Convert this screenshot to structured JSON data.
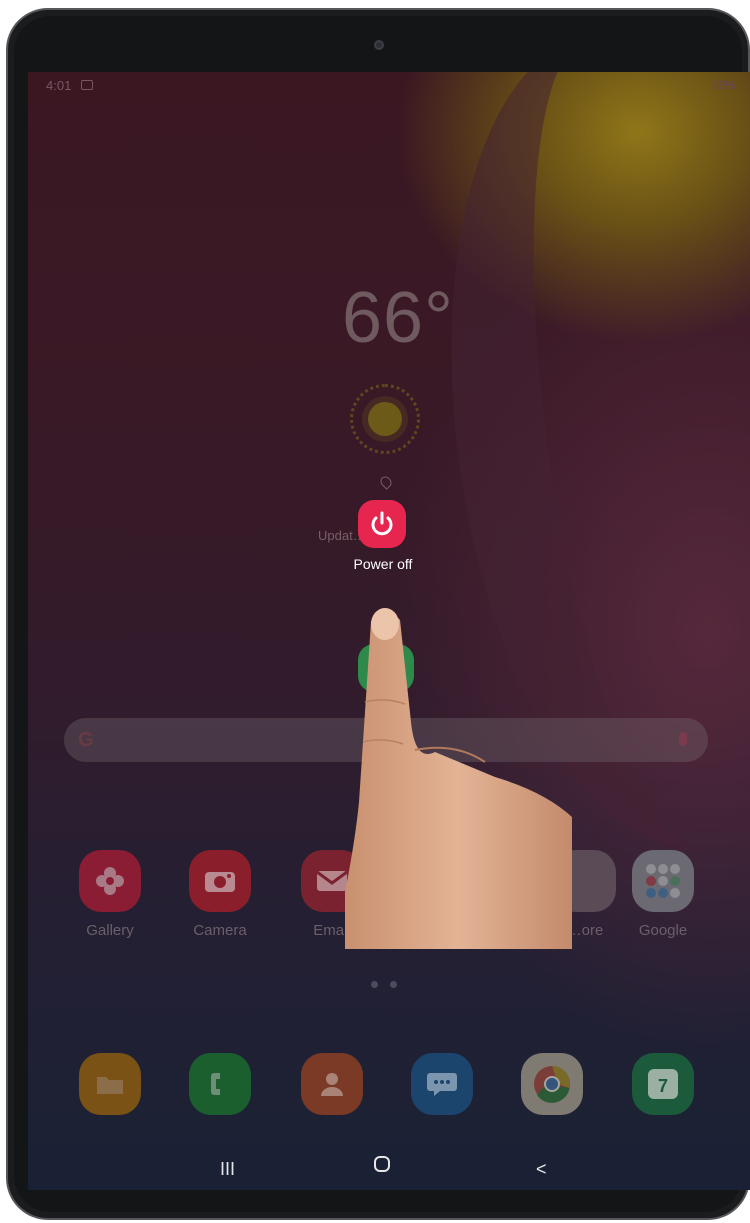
{
  "status_bar": {
    "time": "4:01",
    "battery": "99%"
  },
  "weather": {
    "temperature": "66°",
    "updated": "Updat…20"
  },
  "power_dialog": {
    "label": "Power off",
    "accent": "#e7264f"
  },
  "search": {
    "logo": "G"
  },
  "apps_row": [
    {
      "label": "Gallery",
      "icon": "gallery-flower-icon",
      "color": "#8a1c34"
    },
    {
      "label": "Camera",
      "icon": "camera-icon",
      "color": "#8a1f2b"
    },
    {
      "label": "Email",
      "icon": "email-icon",
      "color": "#7a2230"
    },
    {
      "label": "…ore",
      "icon": "store-icon",
      "color": "#5a4b56"
    },
    {
      "label": "Google",
      "icon": "google-folder-icon",
      "color": "#6b6a72"
    }
  ],
  "dock": [
    {
      "icon": "files-folder-icon",
      "color": "#7a5216"
    },
    {
      "icon": "phone-icon",
      "color": "#1b5f2f"
    },
    {
      "icon": "contacts-icon",
      "color": "#7b3a26"
    },
    {
      "icon": "messages-icon",
      "color": "#1c456e"
    },
    {
      "icon": "chrome-icon",
      "color": "#7f7a72"
    },
    {
      "icon": "calendar-icon",
      "color": "#1b5a3b",
      "text": "7"
    }
  ],
  "nav_bar": {
    "recents": "III",
    "home": "O",
    "back": "<"
  }
}
